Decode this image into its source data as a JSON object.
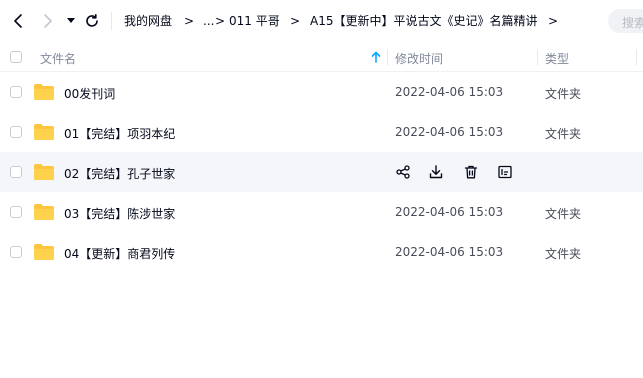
{
  "toolbar": {
    "breadcrumb": [
      "我的网盘",
      "...",
      "011 平哥",
      "A15【更新中】平说古文《史记》名篇精讲"
    ],
    "separator": ">",
    "search_placeholder": "搜索"
  },
  "table": {
    "columns": {
      "name": "文件名",
      "modified": "修改时间",
      "type": "类型"
    },
    "rows": [
      {
        "name": "00发刊词",
        "modified": "2022-04-06 15:03",
        "type": "文件夹",
        "hovered": false
      },
      {
        "name": "01【完结】项羽本纪",
        "modified": "2022-04-06 15:03",
        "type": "文件夹",
        "hovered": false
      },
      {
        "name": "02【完结】孔子世家",
        "modified": "",
        "type": "",
        "hovered": true
      },
      {
        "name": "03【完结】陈涉世家",
        "modified": "2022-04-06 15:03",
        "type": "文件夹",
        "hovered": false
      },
      {
        "name": "04【更新】商君列传",
        "modified": "2022-04-06 15:03",
        "type": "文件夹",
        "hovered": false
      }
    ],
    "hover_actions": [
      "share-icon",
      "download-icon",
      "delete-icon",
      "rename-icon"
    ]
  },
  "colors": {
    "folder": "#ffc53d",
    "sort_arrow": "#06a7ff",
    "hover_row": "#f5f6f9"
  }
}
